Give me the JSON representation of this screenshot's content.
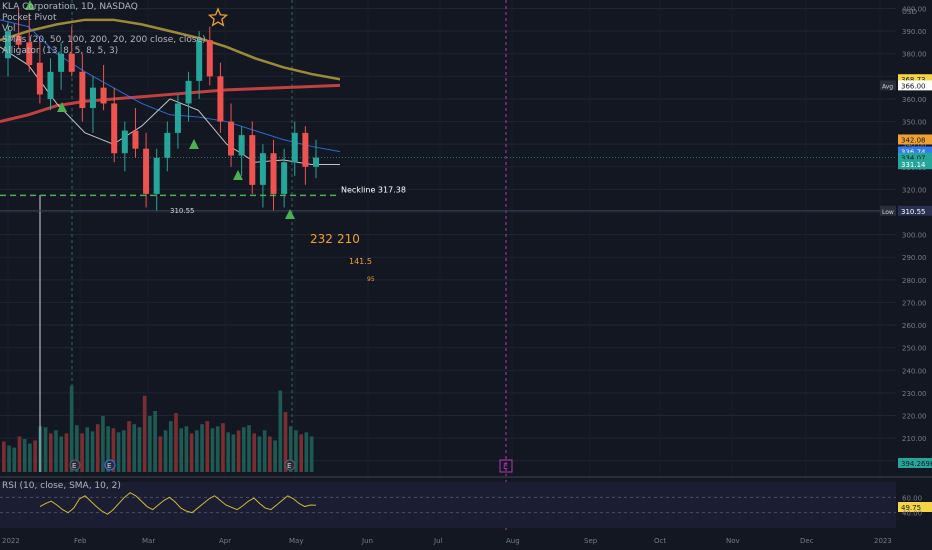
{
  "legend": [
    "KLA Corporation, 1D, NASDAQ",
    "Pocket Pivot",
    "Vol",
    "SMAs (20, 50, 100, 200, 20, 200 close, close)",
    "Alligator (13, 8, 5, 8, 5, 3)"
  ],
  "rsi_label": "RSI (10, close, SMA, 10, 2)",
  "price_axis": {
    "ticks": [
      400,
      390,
      380,
      370,
      360,
      350,
      340,
      330,
      320,
      310,
      300,
      290,
      280,
      270,
      260,
      250,
      240,
      230,
      220,
      210,
      200
    ],
    "tick_labels": [
      "400.00",
      "390.00",
      "380.00",
      "370.00",
      "360.00",
      "350.00",
      "340.00",
      "330.00",
      "320.00",
      "310.00",
      "300.00",
      "290.00",
      "280.00",
      "270.00",
      "260.00",
      "250.00",
      "240.00",
      "230.00",
      "220.00",
      "210.00",
      "200.00"
    ],
    "currency": "USD",
    "ylim": [
      195,
      402
    ]
  },
  "rsi_axis": {
    "ticks": [
      60,
      40
    ],
    "tick_labels": [
      "60.00",
      "40.00"
    ]
  },
  "time_axis": {
    "labels": [
      "2022",
      "Feb",
      "Mar",
      "Apr",
      "May",
      "Jun",
      "Jul",
      "Aug",
      "Sep",
      "Oct",
      "Nov",
      "Dec",
      "2023"
    ]
  },
  "badges": [
    {
      "text": "368.73",
      "value": 368.73,
      "color": "#f5d445",
      "text_color": "#131722"
    },
    {
      "text": "366.00",
      "value": 366.0,
      "color": "#ffffff",
      "text_color": "#131722",
      "tag": "Avg"
    },
    {
      "text": "342.08",
      "value": 342.08,
      "color": "#f0a030",
      "text_color": "#131722"
    },
    {
      "text": "336.74",
      "value": 336.74,
      "color": "#3179f5",
      "text_color": "#ffffff"
    },
    {
      "text": "334.07",
      "value": 334.07,
      "color": "#26a69a",
      "text_color": "#131722"
    },
    {
      "text": "331.14",
      "value": 331.14,
      "color": "#26a69a",
      "text_color": "#ffffff"
    },
    {
      "text": "310.55",
      "value": 310.55,
      "color": "#2a3050",
      "text_color": "#ffffff",
      "tag": "Low"
    },
    {
      "text": "394.269K",
      "value": 0,
      "color": "#26a69a",
      "text_color": "#131722",
      "pane": "volume"
    },
    {
      "text": "49.75",
      "value": 49.75,
      "color": "#f5d445",
      "text_color": "#131722",
      "pane": "rsi"
    }
  ],
  "annotations": {
    "neckline": {
      "label": "Neckline 317.38",
      "value": 317.38
    },
    "low": {
      "label": "310.55",
      "value": 310.55
    },
    "targets": [
      "232",
      "210",
      "141.5",
      "95"
    ]
  },
  "chart_data": {
    "type": "candlestick",
    "title": "KLA Corporation, 1D, NASDAQ",
    "ylim": [
      195,
      402
    ],
    "series": [
      {
        "name": "SMA 200",
        "color": "#e04848",
        "values": [
          350,
          353,
          357,
          359,
          360,
          361,
          362,
          363,
          364,
          364.5,
          365,
          365.5,
          366
        ]
      },
      {
        "name": "SMA 100",
        "color": "#b59f3b",
        "values": [
          386,
          390,
          393,
          395,
          395,
          393,
          390,
          387,
          383,
          378,
          374,
          371,
          368.7
        ]
      },
      {
        "name": "SMA 50",
        "color": "#3179f5",
        "values": [
          395,
          392,
          380,
          372,
          365,
          358,
          353,
          352,
          350,
          346,
          342,
          339,
          336.7
        ]
      },
      {
        "name": "SMA 20",
        "color": "#e0e0e0",
        "values": [
          383,
          375,
          358,
          345,
          340,
          348,
          360,
          355,
          340,
          332,
          333,
          331,
          331
        ]
      }
    ],
    "ohlc": [
      {
        "o": 378,
        "h": 394,
        "l": 370,
        "c": 390
      },
      {
        "o": 388,
        "h": 400,
        "l": 382,
        "c": 384
      },
      {
        "o": 385,
        "h": 398,
        "l": 372,
        "c": 375
      },
      {
        "o": 376,
        "h": 386,
        "l": 358,
        "c": 362
      },
      {
        "o": 360,
        "h": 378,
        "l": 355,
        "c": 372
      },
      {
        "o": 372,
        "h": 385,
        "l": 364,
        "c": 380
      },
      {
        "o": 380,
        "h": 392,
        "l": 370,
        "c": 372
      },
      {
        "o": 372,
        "h": 380,
        "l": 350,
        "c": 356
      },
      {
        "o": 356,
        "h": 370,
        "l": 345,
        "c": 365
      },
      {
        "o": 365,
        "h": 375,
        "l": 355,
        "c": 358
      },
      {
        "o": 358,
        "h": 365,
        "l": 332,
        "c": 336
      },
      {
        "o": 336,
        "h": 350,
        "l": 328,
        "c": 346
      },
      {
        "o": 346,
        "h": 356,
        "l": 334,
        "c": 338
      },
      {
        "o": 338,
        "h": 345,
        "l": 312,
        "c": 318
      },
      {
        "o": 318,
        "h": 338,
        "l": 310.55,
        "c": 334
      },
      {
        "o": 334,
        "h": 350,
        "l": 328,
        "c": 345
      },
      {
        "o": 345,
        "h": 362,
        "l": 338,
        "c": 358
      },
      {
        "o": 358,
        "h": 372,
        "l": 350,
        "c": 368
      },
      {
        "o": 368,
        "h": 390,
        "l": 360,
        "c": 386
      },
      {
        "o": 386,
        "h": 392,
        "l": 366,
        "c": 370
      },
      {
        "o": 370,
        "h": 376,
        "l": 345,
        "c": 350
      },
      {
        "o": 350,
        "h": 358,
        "l": 330,
        "c": 335
      },
      {
        "o": 335,
        "h": 348,
        "l": 326,
        "c": 344
      },
      {
        "o": 344,
        "h": 350,
        "l": 318,
        "c": 322
      },
      {
        "o": 322,
        "h": 340,
        "l": 312,
        "c": 336
      },
      {
        "o": 336,
        "h": 342,
        "l": 310.55,
        "c": 318
      },
      {
        "o": 318,
        "h": 338,
        "l": 312,
        "c": 332
      },
      {
        "o": 332,
        "h": 350,
        "l": 326,
        "c": 345
      },
      {
        "o": 345,
        "h": 348,
        "l": 322,
        "c": 330
      },
      {
        "o": 330,
        "h": 342,
        "l": 325,
        "c": 334.07
      }
    ],
    "volume_max": 2400,
    "volume": [
      600,
      520,
      480,
      700,
      650,
      560,
      620,
      900,
      880,
      760,
      820,
      700,
      760,
      1700,
      920,
      760,
      880,
      800,
      940,
      1100,
      900,
      860,
      780,
      820,
      1000,
      940,
      880,
      1500,
      1100,
      1200,
      700,
      820,
      1000,
      1160,
      860,
      900,
      760,
      820,
      940,
      1000,
      860,
      900,
      960,
      780,
      740,
      820,
      880,
      920,
      760,
      700,
      820,
      700,
      620,
      1600,
      1180,
      900,
      820,
      740,
      780,
      700
    ],
    "rsi": [
      48,
      52,
      55,
      50,
      44,
      40,
      46,
      58,
      62,
      55,
      48,
      42,
      38,
      44,
      52,
      60,
      66,
      62,
      55,
      48,
      44,
      50,
      56,
      60,
      54,
      46,
      42,
      40,
      46,
      52,
      58,
      62,
      56,
      50,
      47,
      44,
      49,
      55,
      59,
      52,
      46,
      44,
      50,
      56,
      62,
      58,
      52,
      48,
      50,
      49.75
    ],
    "vertical_lines": [
      {
        "month": "Jan",
        "style": "dashed"
      },
      {
        "month": "Apr",
        "style": "dashed"
      },
      {
        "month": "Aug",
        "style": "dashed",
        "color": "#b33ab3"
      }
    ]
  }
}
